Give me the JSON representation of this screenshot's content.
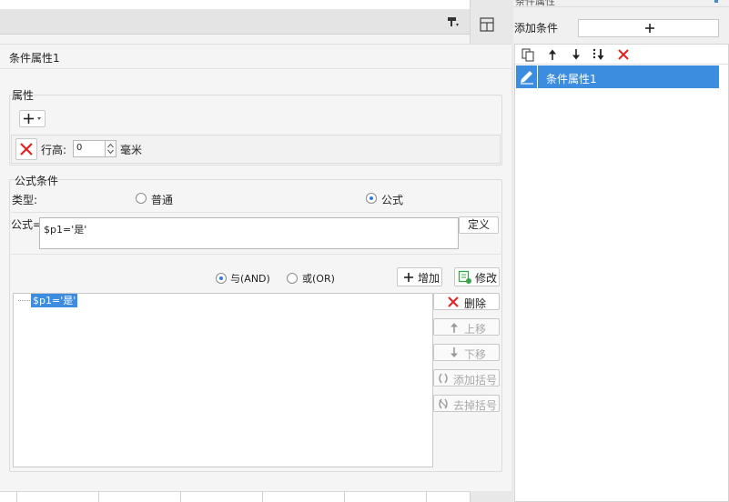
{
  "window": {
    "title": "条件属性"
  },
  "left_panel": {
    "title": "条件属性1"
  },
  "attributes": {
    "legend": "属性",
    "row_height_label": "行高:",
    "row_height_value": "0",
    "row_height_unit": "毫米"
  },
  "formula_conditions": {
    "legend": "公式条件",
    "type_label": "类型:",
    "type_options": [
      {
        "label": "普通",
        "selected": false
      },
      {
        "label": "公式",
        "selected": true
      }
    ],
    "formula_label": "公式=",
    "formula_value": "$p1='是'",
    "define_label": "定义",
    "logic_options": [
      {
        "label": "与(AND)",
        "selected": true
      },
      {
        "label": "或(OR)",
        "selected": false
      }
    ],
    "add_label": "增加",
    "modify_label": "修改",
    "conditions": [
      "$p1='是'"
    ],
    "delete_label": "删除",
    "up_label": "上移",
    "down_label": "下移",
    "add_bracket_label": "添加括号",
    "remove_bracket_label": "去掉括号"
  },
  "right_panel": {
    "add_condition_label": "添加条件",
    "add_condition_symbol": "+",
    "items": [
      {
        "label": "条件属性1",
        "selected": true
      }
    ]
  },
  "colors": {
    "accent": "#3c8de0",
    "delete_red": "#e02424",
    "modify_green": "#3aa34a"
  }
}
